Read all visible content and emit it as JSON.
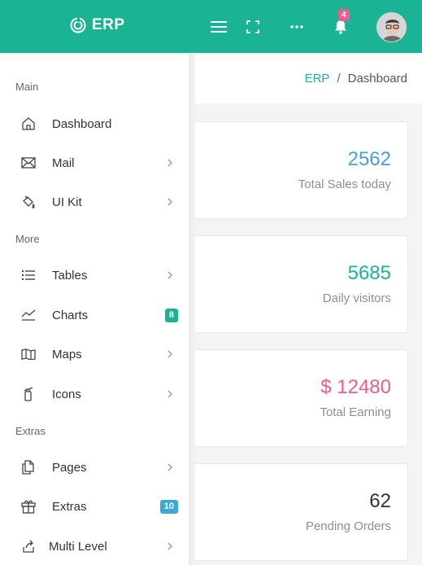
{
  "header": {
    "brand_name": "ERP",
    "notification_count": "4",
    "icons": [
      "logo-icon",
      "menu-icon",
      "fullscreen-icon",
      "more-icon",
      "bell-icon",
      "avatar"
    ]
  },
  "breadcrumb": {
    "root": "ERP",
    "separator": "/",
    "current": "Dashboard"
  },
  "cards": [
    {
      "value": "2562",
      "label": "Total Sales today",
      "color": "#4a9fd5"
    },
    {
      "value": "5685",
      "label": "Daily visitors",
      "color": "#1ab394"
    },
    {
      "value": "$ 12480",
      "label": "Total Earning",
      "color": "#ef5b8e"
    },
    {
      "value": "62",
      "label": "Pending Orders",
      "color": "#333333"
    }
  ],
  "sidebar": {
    "sections": [
      {
        "title": "Main"
      },
      {
        "title": "More"
      },
      {
        "title": "Extras"
      }
    ],
    "items": [
      {
        "label": "Dashboard",
        "icon": "home-icon"
      },
      {
        "label": "Mail",
        "icon": "envelope-icon"
      },
      {
        "label": "UI Kit",
        "icon": "paint-bucket-icon"
      },
      {
        "label": "Tables",
        "icon": "list-icon"
      },
      {
        "label": "Charts",
        "icon": "line-chart-icon",
        "badge": "8"
      },
      {
        "label": "Maps",
        "icon": "map-icon"
      },
      {
        "label": "Icons",
        "icon": "extinguisher-icon"
      },
      {
        "label": "Pages",
        "icon": "pages-icon"
      },
      {
        "label": "Extras",
        "icon": "gift-icon",
        "badge": "10"
      },
      {
        "label": "Multi Level",
        "icon": "share-icon"
      }
    ]
  },
  "colors": {
    "primary": "#1ab394",
    "badge_green": "#1ab394",
    "badge_blue": "#3ca8d8",
    "notif_pink": "#ef5b8e"
  }
}
